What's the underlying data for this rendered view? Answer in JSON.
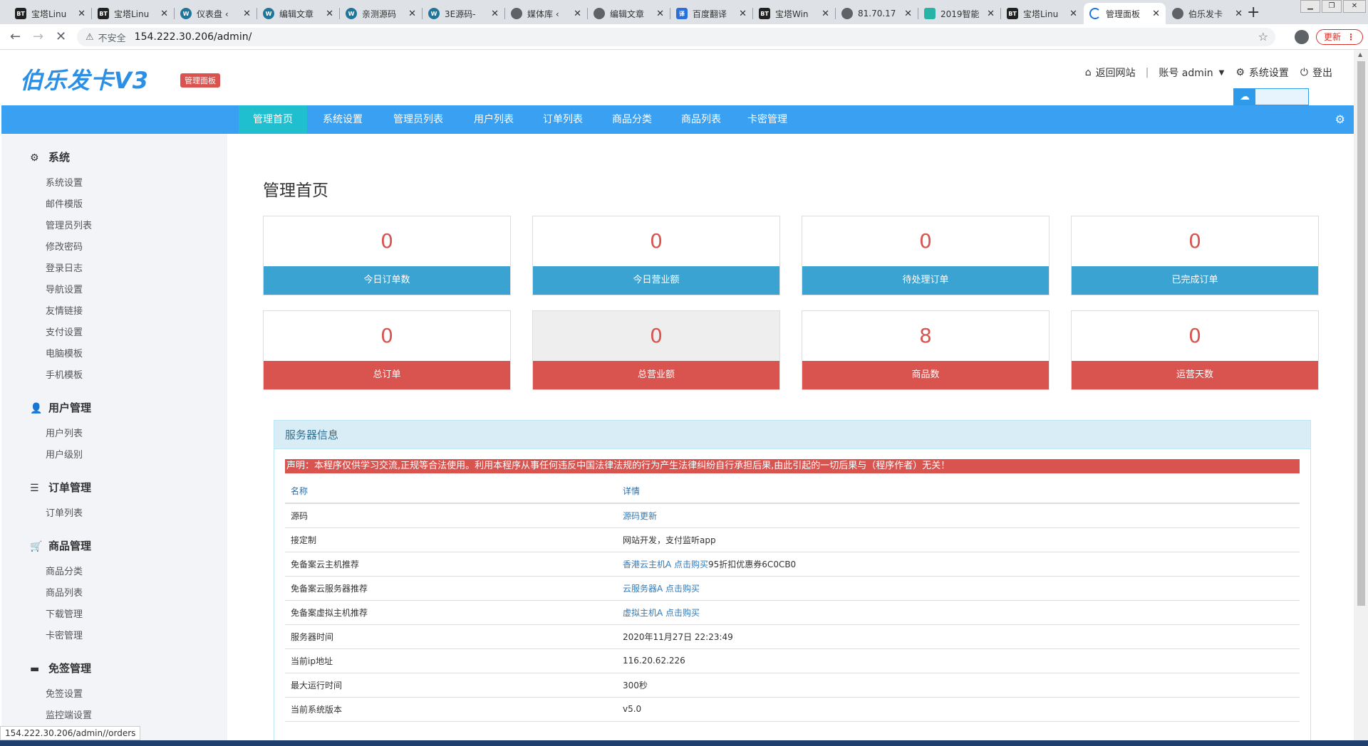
{
  "browser": {
    "tabs": [
      {
        "label": "宝塔Linu",
        "favicon": "BT"
      },
      {
        "label": "宝塔Linu",
        "favicon": "BT"
      },
      {
        "label": "仪表盘 ‹",
        "favicon": "W"
      },
      {
        "label": "编辑文章",
        "favicon": "W"
      },
      {
        "label": "亲测源码",
        "favicon": "W"
      },
      {
        "label": "3E源码-",
        "favicon": "W"
      },
      {
        "label": "媒体库 ‹",
        "favicon": ""
      },
      {
        "label": "编辑文章",
        "favicon": ""
      },
      {
        "label": "百度翻译",
        "favicon": "译"
      },
      {
        "label": "宝塔Win",
        "favicon": "BT"
      },
      {
        "label": "81.70.17",
        "favicon": ""
      },
      {
        "label": "2019智能",
        "favicon": ""
      },
      {
        "label": "宝塔Linu",
        "favicon": "BT"
      },
      {
        "label": "管理面板",
        "favicon": ""
      },
      {
        "label": "伯乐发卡",
        "favicon": ""
      }
    ],
    "new_tab": "+",
    "insecure_label": "不安全",
    "url": "154.222.30.206/admin/",
    "update_label": "更新",
    "status_url": "154.222.30.206/admin//orders"
  },
  "header": {
    "logo": "伯乐发卡V3",
    "badge": "管理面板",
    "back_site": "返回网站",
    "account": "账号 admin",
    "settings": "系统设置",
    "logout": "登出"
  },
  "nav": [
    {
      "label": "管理首页",
      "active": true
    },
    {
      "label": "系统设置"
    },
    {
      "label": "管理员列表"
    },
    {
      "label": "用户列表"
    },
    {
      "label": "订单列表"
    },
    {
      "label": "商品分类"
    },
    {
      "label": "商品列表"
    },
    {
      "label": "卡密管理"
    }
  ],
  "sidebar": {
    "groups": [
      {
        "title": "系统",
        "icon": "gear-icon",
        "items": [
          "系统设置",
          "邮件模版",
          "管理员列表",
          "修改密码",
          "登录日志",
          "导航设置",
          "友情链接",
          "支付设置",
          "电脑模板",
          "手机模板"
        ]
      },
      {
        "title": "用户管理",
        "icon": "user-icon",
        "items": [
          "用户列表",
          "用户级别"
        ]
      },
      {
        "title": "订单管理",
        "icon": "list-icon",
        "items": [
          "订单列表"
        ]
      },
      {
        "title": "商品管理",
        "icon": "cart-icon",
        "items": [
          "商品分类",
          "商品列表",
          "下载管理",
          "卡密管理"
        ]
      },
      {
        "title": "免签管理",
        "icon": "card-icon",
        "items": [
          "免签设置",
          "监控端设置"
        ]
      }
    ]
  },
  "page_title": "管理首页",
  "stats": [
    {
      "value": "0",
      "label": "今日订单数"
    },
    {
      "value": "0",
      "label": "今日营业额"
    },
    {
      "value": "0",
      "label": "待处理订单"
    },
    {
      "value": "0",
      "label": "已完成订单"
    },
    {
      "value": "0",
      "label": "总订单"
    },
    {
      "value": "0",
      "label": "总营业额"
    },
    {
      "value": "8",
      "label": "商品数"
    },
    {
      "value": "0",
      "label": "运营天数"
    }
  ],
  "server_panel": {
    "title": "服务器信息",
    "notice": "声明：本程序仅供学习交流,正规等合法使用。利用本程序从事任何违反中国法律法规的行为产生法律纠纷自行承担后果,由此引起的一切后果与（程序作者）无关！",
    "headers": [
      "名称",
      "详情"
    ],
    "rows": [
      {
        "name": "源码",
        "link": "源码更新",
        "text": ""
      },
      {
        "name": "接定制",
        "link": "",
        "text": "网站开发，支付监听app"
      },
      {
        "name": "免备案云主机推荐",
        "link": "香港云主机A 点击购买",
        "text": "95折扣优惠券6C0CB0"
      },
      {
        "name": "免备案云服务器推荐",
        "link": "云服务器A 点击购买",
        "text": ""
      },
      {
        "name": "免备案虚拟主机推荐",
        "link": "虚拟主机A 点击购买",
        "text": ""
      },
      {
        "name": "服务器时间",
        "link": "",
        "text": "2020年11月27日 22:23:49"
      },
      {
        "name": "当前ip地址",
        "link": "",
        "text": "116.20.62.226"
      },
      {
        "name": "最大运行时间",
        "link": "",
        "text": "300秒"
      },
      {
        "name": "当前系统版本",
        "link": "",
        "text": "v5.0"
      }
    ]
  },
  "colors": {
    "nav_bg": "#3aa0f2",
    "nav_active": "#1fbfcf",
    "stat_blue": "#3aa3d2",
    "stat_red": "#d9534f",
    "logo": "#2b8fe6"
  }
}
